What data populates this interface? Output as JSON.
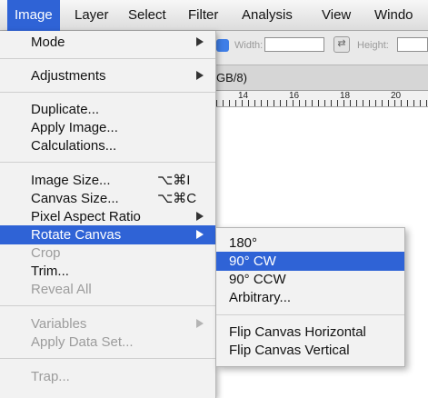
{
  "menubar": {
    "items": [
      {
        "label": "Image",
        "active": true
      },
      {
        "label": "Layer"
      },
      {
        "label": "Select"
      },
      {
        "label": "Filter"
      },
      {
        "label": "Analysis"
      },
      {
        "label": "View"
      },
      {
        "label": "Windo"
      }
    ]
  },
  "toolbar": {
    "width_label": "Width:",
    "height_label": "Height:",
    "swap_icon": "swap-arrows-icon"
  },
  "document": {
    "tab_title_fragment": "GB/8)",
    "ruler_numbers": [
      "14",
      "16",
      "18",
      "20"
    ]
  },
  "image_menu": {
    "items": [
      {
        "label": "Mode",
        "has_submenu": true
      },
      {
        "label": "Adjustments",
        "has_submenu": true
      },
      {
        "label": "Duplicate..."
      },
      {
        "label": "Apply Image..."
      },
      {
        "label": "Calculations..."
      },
      {
        "label": "Image Size...",
        "shortcut": "⌥⌘I"
      },
      {
        "label": "Canvas Size...",
        "shortcut": "⌥⌘C"
      },
      {
        "label": "Pixel Aspect Ratio",
        "has_submenu": true
      },
      {
        "label": "Rotate Canvas",
        "has_submenu": true,
        "highlighted": true
      },
      {
        "label": "Crop",
        "disabled": true
      },
      {
        "label": "Trim..."
      },
      {
        "label": "Reveal All",
        "disabled": true
      },
      {
        "label": "Variables",
        "has_submenu": true,
        "disabled": true
      },
      {
        "label": "Apply Data Set...",
        "disabled": true
      },
      {
        "label": "Trap...",
        "disabled": true
      }
    ]
  },
  "rotate_submenu": {
    "items": [
      {
        "label": "180°"
      },
      {
        "label": "90° CW",
        "highlighted": true
      },
      {
        "label": "90° CCW"
      },
      {
        "label": "Arbitrary..."
      },
      {
        "label": "Flip Canvas Horizontal"
      },
      {
        "label": "Flip Canvas Vertical"
      }
    ]
  },
  "colors": {
    "highlight": "#2f63d6",
    "menu_bg": "#f2f2f2",
    "disabled_text": "#9c9c9c"
  }
}
